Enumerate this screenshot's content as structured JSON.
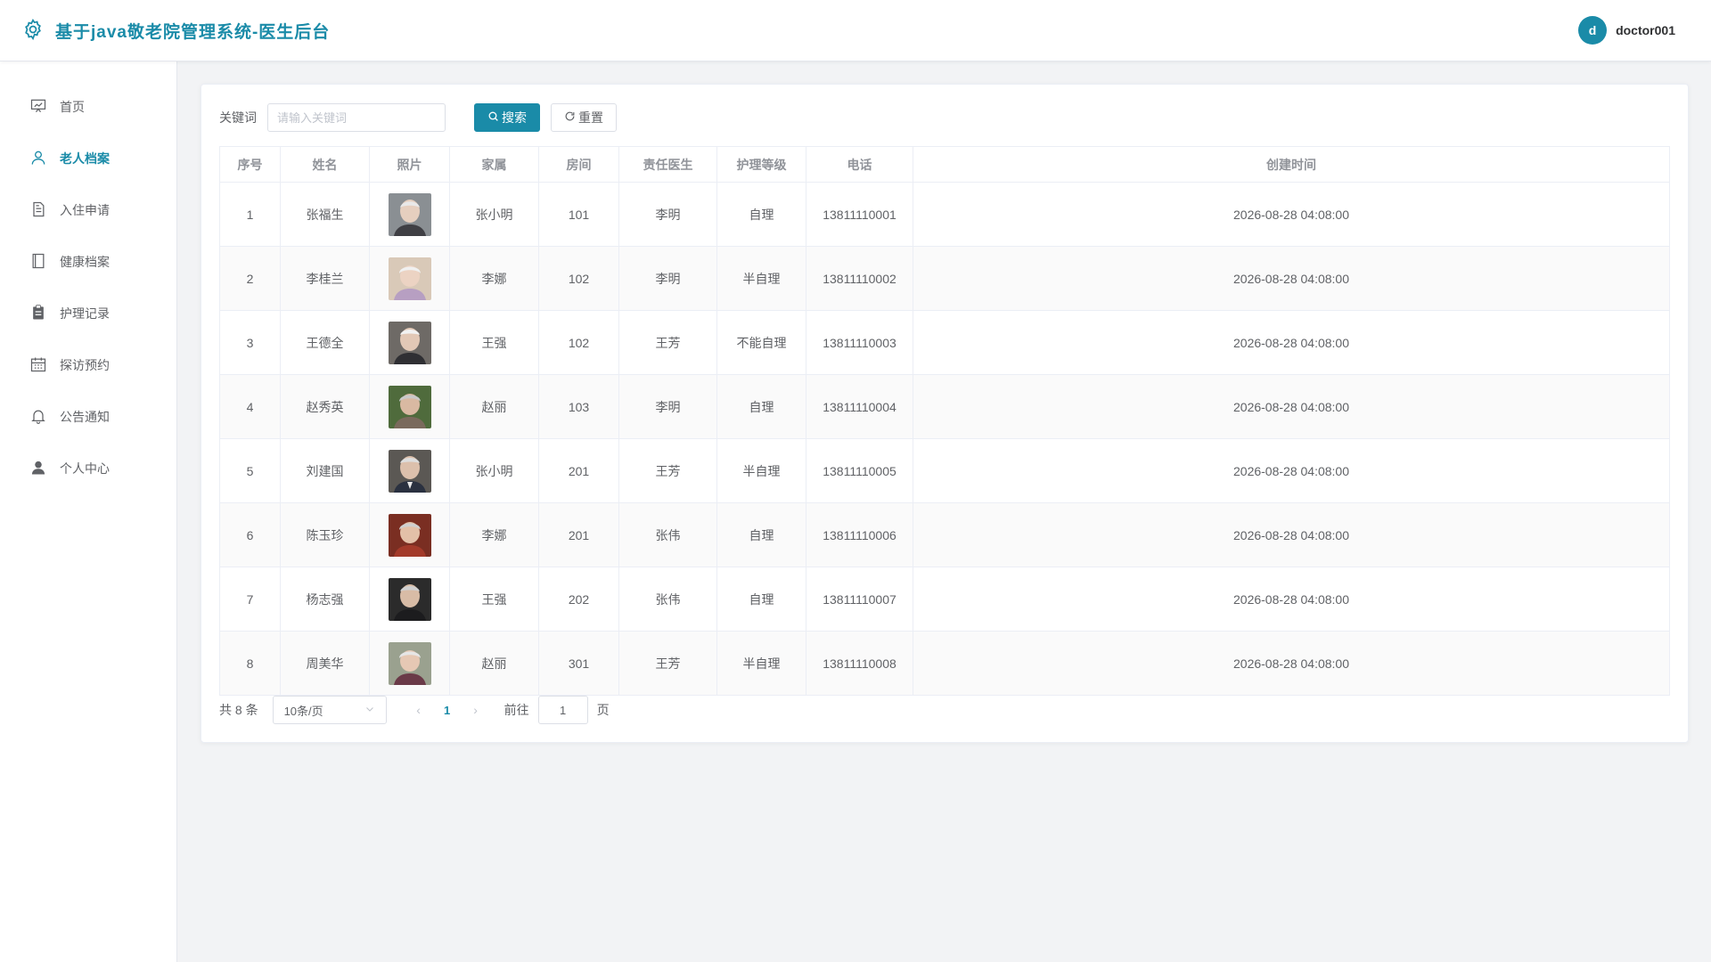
{
  "header": {
    "title": "基于java敬老院管理系统-医生后台",
    "user_initial": "d",
    "username": "doctor001"
  },
  "colors": {
    "accent": "#1a8ba8",
    "stripe": "#fafafa"
  },
  "sidebar": {
    "items": [
      {
        "label": "首页",
        "icon": "dashboard-icon"
      },
      {
        "label": "老人档案",
        "icon": "user-icon",
        "active": true
      },
      {
        "label": "入住申请",
        "icon": "document-icon"
      },
      {
        "label": "健康档案",
        "icon": "notebook-icon"
      },
      {
        "label": "护理记录",
        "icon": "clipboard-icon"
      },
      {
        "label": "探访预约",
        "icon": "calendar-icon"
      },
      {
        "label": "公告通知",
        "icon": "bell-icon"
      },
      {
        "label": "个人中心",
        "icon": "person-icon"
      }
    ]
  },
  "search": {
    "label": "关键词",
    "placeholder": "请输入关键词",
    "search_btn": "搜索",
    "reset_btn": "重置"
  },
  "table": {
    "columns": [
      "序号",
      "姓名",
      "照片",
      "家属",
      "房间",
      "责任医生",
      "护理等级",
      "电话",
      "创建时间"
    ],
    "rows": [
      {
        "no": "1",
        "name": "张福生",
        "family": "张小明",
        "room": "101",
        "doctor": "李明",
        "level": "自理",
        "phone": "13811110001",
        "created": "2026-08-28 04:08:00"
      },
      {
        "no": "2",
        "name": "李桂兰",
        "family": "李娜",
        "room": "102",
        "doctor": "李明",
        "level": "半自理",
        "phone": "13811110002",
        "created": "2026-08-28 04:08:00"
      },
      {
        "no": "3",
        "name": "王德全",
        "family": "王强",
        "room": "102",
        "doctor": "王芳",
        "level": "不能自理",
        "phone": "13811110003",
        "created": "2026-08-28 04:08:00"
      },
      {
        "no": "4",
        "name": "赵秀英",
        "family": "赵丽",
        "room": "103",
        "doctor": "李明",
        "level": "自理",
        "phone": "13811110004",
        "created": "2026-08-28 04:08:00"
      },
      {
        "no": "5",
        "name": "刘建国",
        "family": "张小明",
        "room": "201",
        "doctor": "王芳",
        "level": "半自理",
        "phone": "13811110005",
        "created": "2026-08-28 04:08:00"
      },
      {
        "no": "6",
        "name": "陈玉珍",
        "family": "李娜",
        "room": "201",
        "doctor": "张伟",
        "level": "自理",
        "phone": "13811110006",
        "created": "2026-08-28 04:08:00"
      },
      {
        "no": "7",
        "name": "杨志强",
        "family": "王强",
        "room": "202",
        "doctor": "张伟",
        "level": "自理",
        "phone": "13811110007",
        "created": "2026-08-28 04:08:00"
      },
      {
        "no": "8",
        "name": "周美华",
        "family": "赵丽",
        "room": "301",
        "doctor": "王芳",
        "level": "半自理",
        "phone": "13811110008",
        "created": "2026-08-28 04:08:00"
      }
    ]
  },
  "pagination": {
    "total": "共 8 条",
    "page_size": "10条/页",
    "current_page": "1",
    "goto_label": "前往",
    "goto_value": "1",
    "goto_suffix": "页"
  }
}
